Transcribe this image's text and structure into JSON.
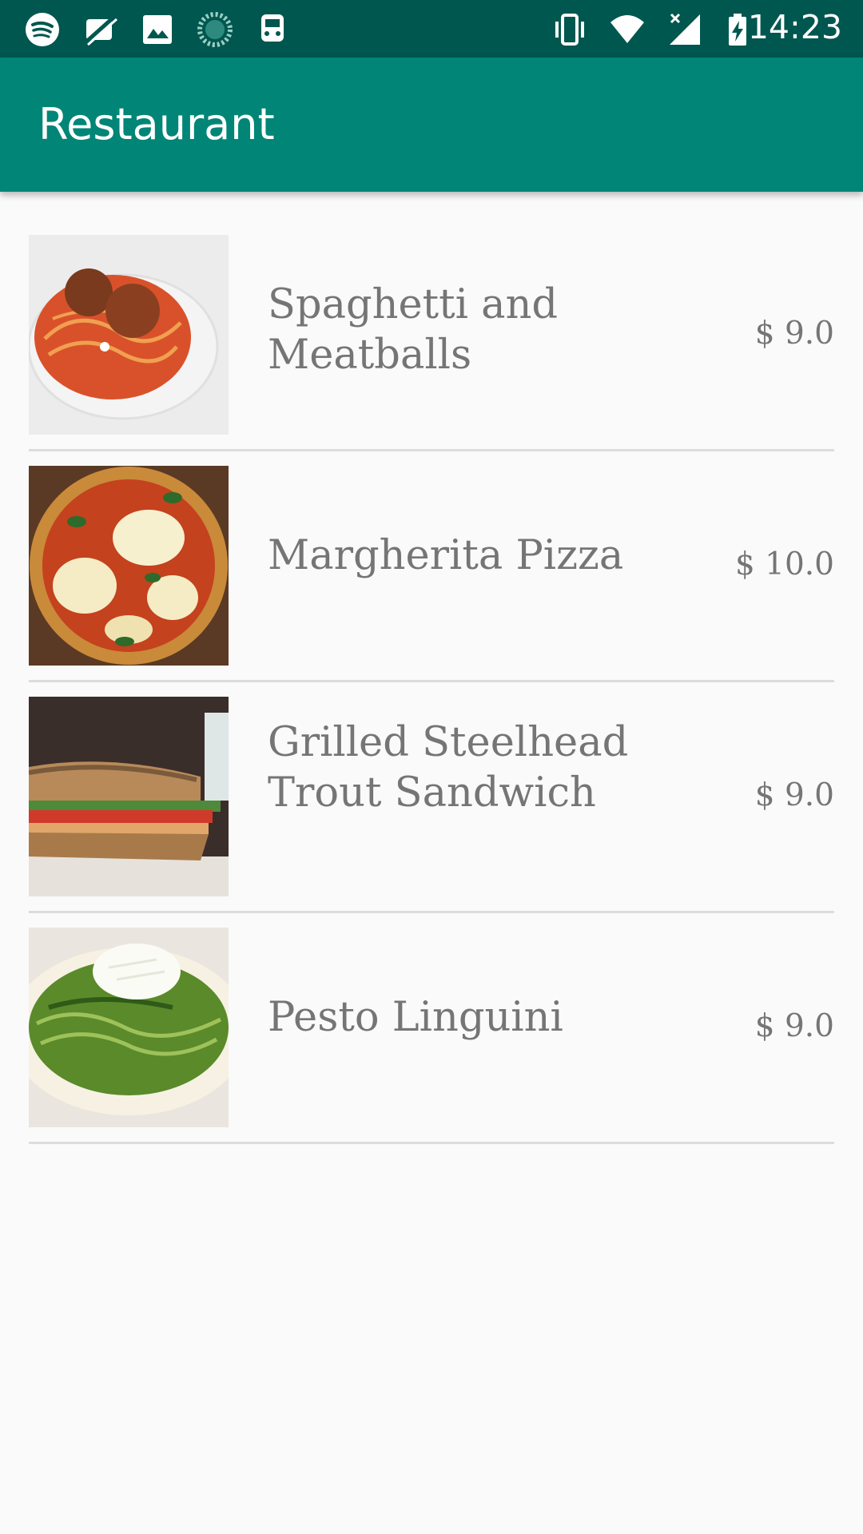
{
  "status_bar": {
    "time": "14:23",
    "icons": [
      "spotify-icon",
      "no-sim-slash-icon",
      "image-icon",
      "loading-circle-icon",
      "train-icon",
      "vibrate-icon",
      "wifi-icon",
      "signal-icon",
      "battery-charging-icon"
    ]
  },
  "app_bar": {
    "title": "Restaurant",
    "color": "#008577",
    "status_color": "#00574f"
  },
  "menu": {
    "items": [
      {
        "name": "Spaghetti and Meatballs",
        "price": "$ 9.0",
        "image": "spaghetti-meatballs-photo"
      },
      {
        "name": "Margherita Pizza",
        "price": "$ 10.0",
        "image": "margherita-pizza-photo"
      },
      {
        "name": "Grilled Steelhead Trout Sandwich",
        "price": "$ 9.0",
        "image": "trout-sandwich-photo"
      },
      {
        "name": "Pesto Linguini",
        "price": "$ 9.0",
        "image": "pesto-linguini-photo"
      }
    ]
  }
}
